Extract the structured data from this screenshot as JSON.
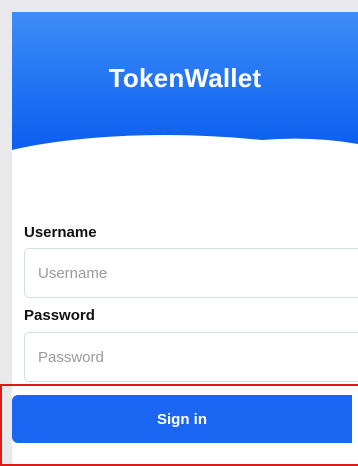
{
  "app": {
    "brand": "TokenWallet"
  },
  "form": {
    "username_label": "Username",
    "username_placeholder": "Username",
    "username_value": "",
    "password_label": "Password",
    "password_placeholder": "Password",
    "password_value": "",
    "signin_label": "Sign in"
  },
  "colors": {
    "brand_gradient_top": "#3d8cf6",
    "brand_gradient_bottom": "#0b5ef0",
    "button_bg": "#1a66f2",
    "highlight_border": "#e01818"
  }
}
